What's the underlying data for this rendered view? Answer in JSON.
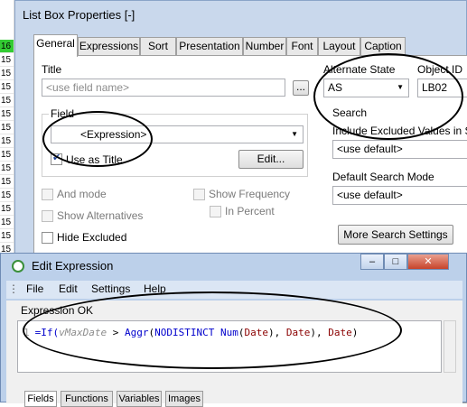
{
  "left_strip": {
    "cells": [
      {
        "text": "16",
        "highlight": true
      },
      {
        "text": "15",
        "highlight": false
      },
      {
        "text": "15",
        "highlight": false
      },
      {
        "text": "15",
        "highlight": false
      },
      {
        "text": "15",
        "highlight": false
      },
      {
        "text": "15",
        "highlight": false
      },
      {
        "text": "15",
        "highlight": false
      },
      {
        "text": "15",
        "highlight": false
      },
      {
        "text": "15",
        "highlight": false
      },
      {
        "text": "15",
        "highlight": false
      },
      {
        "text": "15",
        "highlight": false
      },
      {
        "text": "15",
        "highlight": false
      },
      {
        "text": "15",
        "highlight": false
      },
      {
        "text": "15",
        "highlight": false
      },
      {
        "text": "15",
        "highlight": false
      },
      {
        "text": "15",
        "highlight": false
      },
      {
        "text": "15",
        "highlight": false
      }
    ]
  },
  "list_box_properties": {
    "title": "List Box Properties [-]",
    "tabs": [
      "General",
      "Expressions",
      "Sort",
      "Presentation",
      "Number",
      "Font",
      "Layout",
      "Caption"
    ],
    "active_tab": "General",
    "title_label": "Title",
    "title_placeholder": "<use field name>",
    "title_browse": "...",
    "field_label": "Field",
    "field_value": "<Expression>",
    "use_as_title_label": "Use as Title",
    "edit_button": "Edit...",
    "and_mode_label": "And mode",
    "show_alternatives_label": "Show Alternatives",
    "hide_excluded_label": "Hide Excluded",
    "show_frequency_label": "Show Frequency",
    "in_percent_label": "In Percent",
    "alternate_state_label": "Alternate State",
    "alternate_state_value": "AS",
    "object_id_label": "Object ID",
    "object_id_value": "LB02",
    "search_label": "Search",
    "include_excluded_label": "Include Excluded Values in Sear",
    "include_excluded_value": "<use default>",
    "default_search_mode_label": "Default Search Mode",
    "default_search_mode_value": "<use default>",
    "more_search_button": "More Search Settings"
  },
  "edit_expression": {
    "title": "Edit Expression",
    "window_buttons": [
      "–",
      "□",
      "✕"
    ],
    "menu": [
      "File",
      "Edit",
      "Settings",
      "Help"
    ],
    "status": "Expression OK",
    "line_number": "1",
    "code_parts": {
      "p1": "=If(",
      "p2": "vMaxDate",
      "p3": " > ",
      "p4": "Aggr",
      "p5": "(",
      "p6": "NODISTINCT",
      "p7": " ",
      "p8": "Num",
      "p9": "(",
      "p10": "Date",
      "p11": "), ",
      "p12": "Date",
      "p13": "), ",
      "p14": "Date",
      "p15": ")"
    },
    "bottom_tabs": [
      "Fields",
      "Functions",
      "Variables",
      "Images"
    ]
  }
}
